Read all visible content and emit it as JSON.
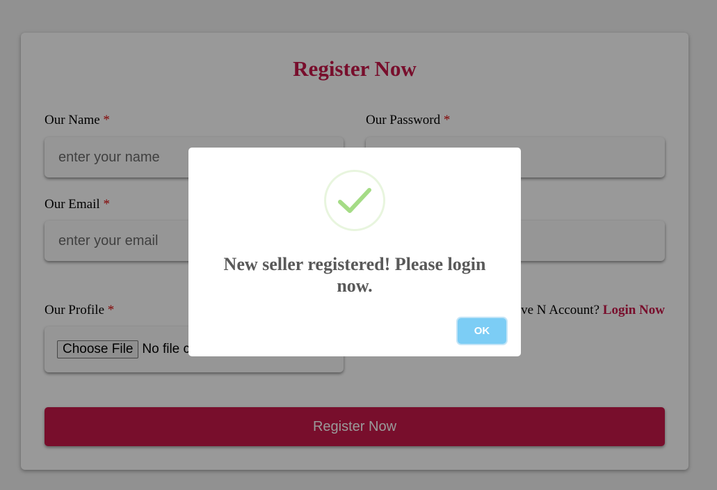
{
  "form": {
    "title": "Register Now",
    "required_mark": "*",
    "name": {
      "label": "Our Name",
      "placeholder": "enter your name"
    },
    "password": {
      "label": "Our Password"
    },
    "email": {
      "label": "Our Email",
      "placeholder": "enter your email"
    },
    "profile": {
      "label": "Our Profile",
      "button_label": "Choose File",
      "status_text": "No file chosen"
    },
    "account_prompt": "Already Have N Account?",
    "login_link": "Login Now",
    "submit_label": "Register Now"
  },
  "modal": {
    "icon": "success-check-icon",
    "message": "New seller registered! Please login now.",
    "ok_label": "OK"
  },
  "colors": {
    "accent": "#c8184a",
    "ok_button": "#7ccdf5",
    "check": "#a5dc86"
  }
}
